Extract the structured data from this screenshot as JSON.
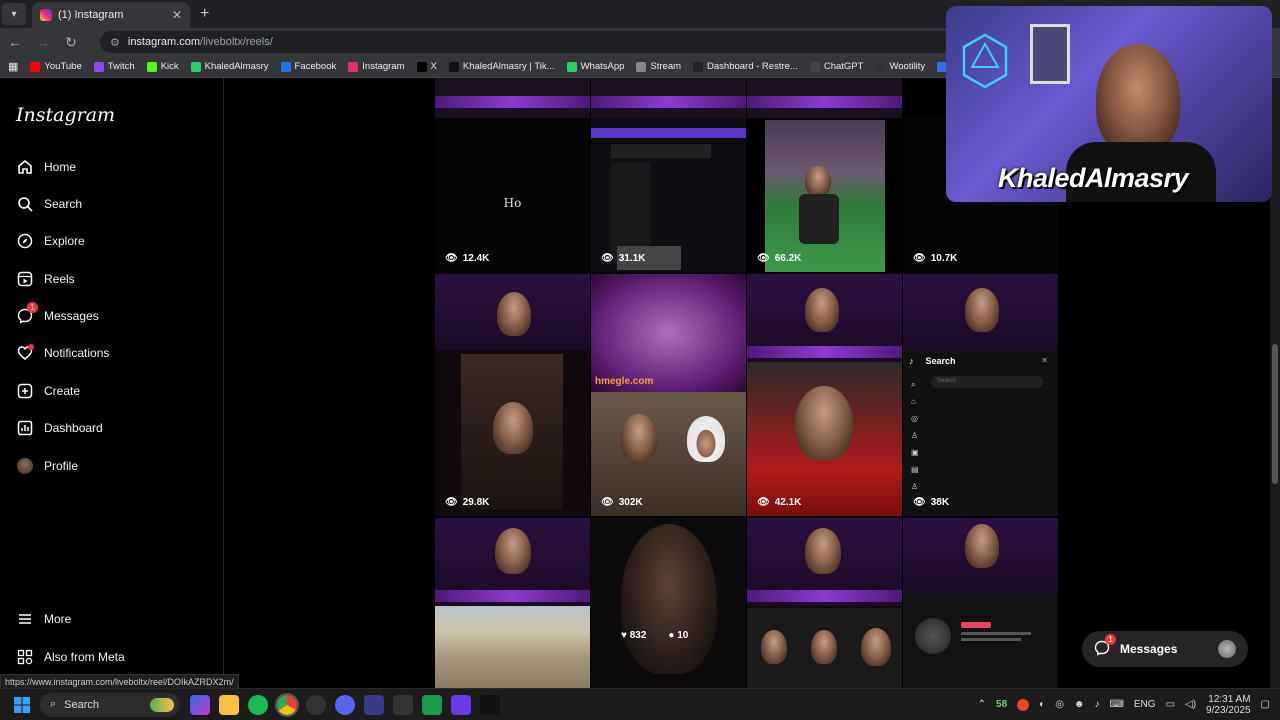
{
  "browser": {
    "tab_title": "(1) Instagram",
    "url_host": "instagram.com",
    "url_path": "/liveboltx/reels/",
    "bookmarks": [
      {
        "label": "YouTube",
        "color": "#ff0000"
      },
      {
        "label": "Twitch",
        "color": "#9146ff"
      },
      {
        "label": "Kick",
        "color": "#53fc18"
      },
      {
        "label": "KhaledAlmasry",
        "color": "#2ecc71"
      },
      {
        "label": "Facebook",
        "color": "#1877f2"
      },
      {
        "label": "Instagram",
        "color": "#e1306c"
      },
      {
        "label": "X",
        "color": "#000000"
      },
      {
        "label": "KhaledAlmasry | Tik...",
        "color": "#111111"
      },
      {
        "label": "WhatsApp",
        "color": "#25d366"
      },
      {
        "label": "Stream",
        "color": "#888888"
      },
      {
        "label": "Dashboard - Restre...",
        "color": "#222222"
      },
      {
        "label": "ChatGPT",
        "color": "#444444"
      },
      {
        "label": "Wootility",
        "color": "#333333"
      },
      {
        "label": "KhaledAlmasry",
        "color": "#2f6df6"
      }
    ],
    "status_url": "https://www.instagram.com/liveboltx/reel/DOIkAZRDX2m/"
  },
  "sidebar": {
    "logo": "Instagram",
    "items": [
      {
        "label": "Home",
        "icon": "home-icon"
      },
      {
        "label": "Search",
        "icon": "search-icon"
      },
      {
        "label": "Explore",
        "icon": "compass-icon"
      },
      {
        "label": "Reels",
        "icon": "reels-icon"
      },
      {
        "label": "Messages",
        "icon": "messenger-icon",
        "badge": "1"
      },
      {
        "label": "Notifications",
        "icon": "heart-icon"
      },
      {
        "label": "Create",
        "icon": "plus-square-icon"
      },
      {
        "label": "Dashboard",
        "icon": "chart-icon"
      },
      {
        "label": "Profile",
        "icon": "avatar"
      }
    ],
    "more": "More",
    "meta": "Also from Meta"
  },
  "reels": {
    "row1": [
      "12.4K",
      "31.1K",
      "66.2K",
      "10.7K"
    ],
    "row2": [
      "29.8K",
      "302K",
      "42.1K",
      "38K"
    ],
    "row3_likes": "832",
    "row3_comments": "10",
    "tile_text": "Ho",
    "tiktok_search_title": "Search",
    "tiktok_search_placeholder": "Search"
  },
  "webcam": {
    "name": "KhaledAlmasry"
  },
  "messages_button": {
    "label": "Messages",
    "badge": "1"
  },
  "taskbar": {
    "search": "Search",
    "tray_number": "58",
    "language": "ENG",
    "time": "12:31 AM",
    "date": "9/23/2025"
  }
}
